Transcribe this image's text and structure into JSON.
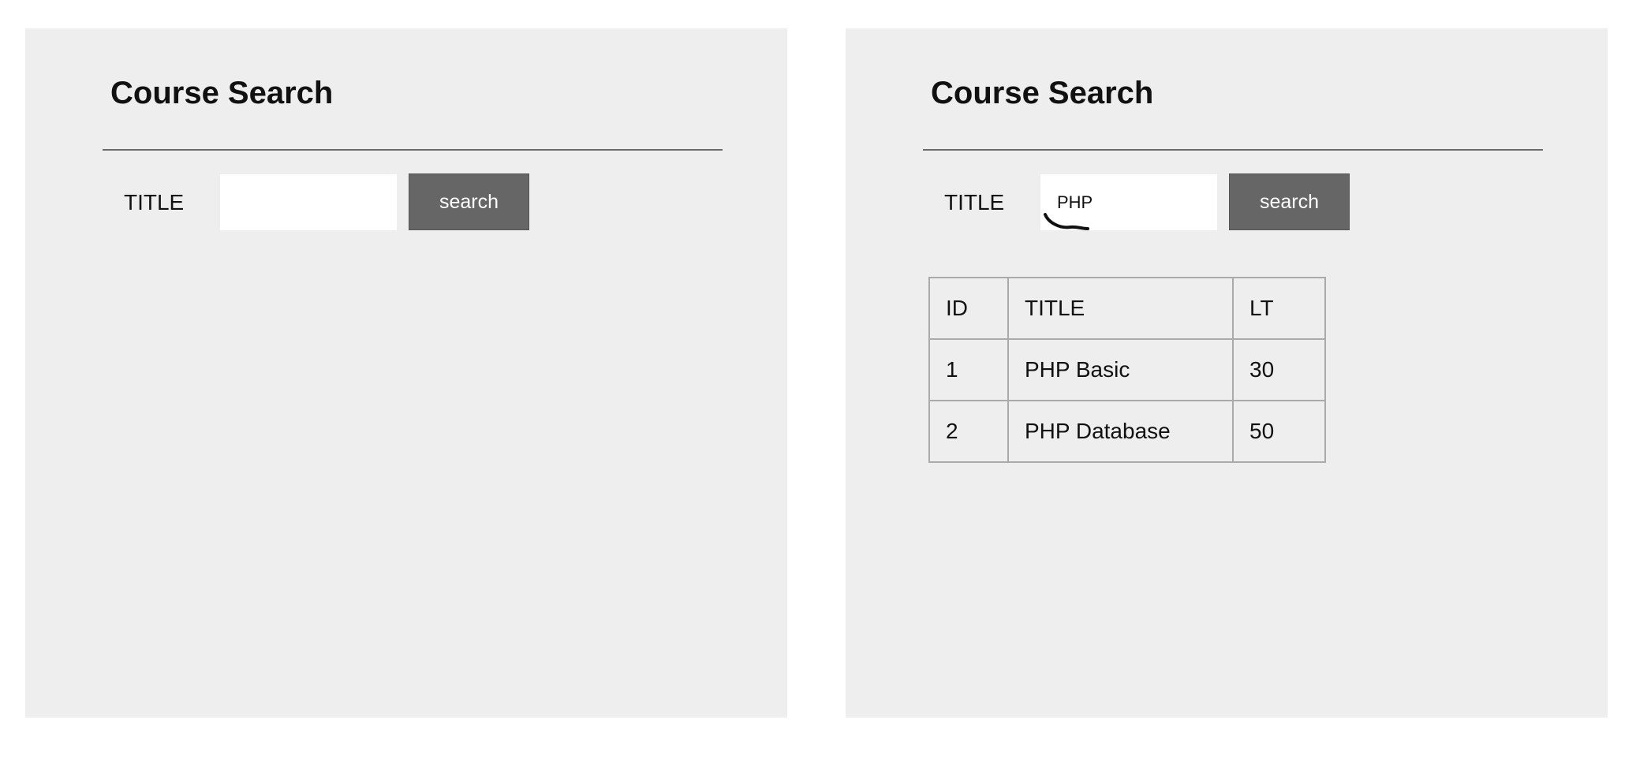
{
  "panels": [
    {
      "title": "Course Search",
      "search": {
        "label": "TITLE",
        "value": "",
        "button_label": "search"
      }
    },
    {
      "title": "Course Search",
      "search": {
        "label": "TITLE",
        "value": "PHP",
        "button_label": "search"
      },
      "results": {
        "columns": [
          "ID",
          "TITLE",
          "LT"
        ],
        "rows": [
          [
            "1",
            "PHP Basic",
            "30"
          ],
          [
            "2",
            "PHP Database",
            "50"
          ]
        ]
      }
    }
  ],
  "colors": {
    "panel_background": "#eeeeee",
    "divider": "#6a6a6a",
    "button_background": "#666666",
    "button_text": "#ffffff",
    "table_border": "#aaaaaa",
    "annotation_stroke": "#111111"
  }
}
